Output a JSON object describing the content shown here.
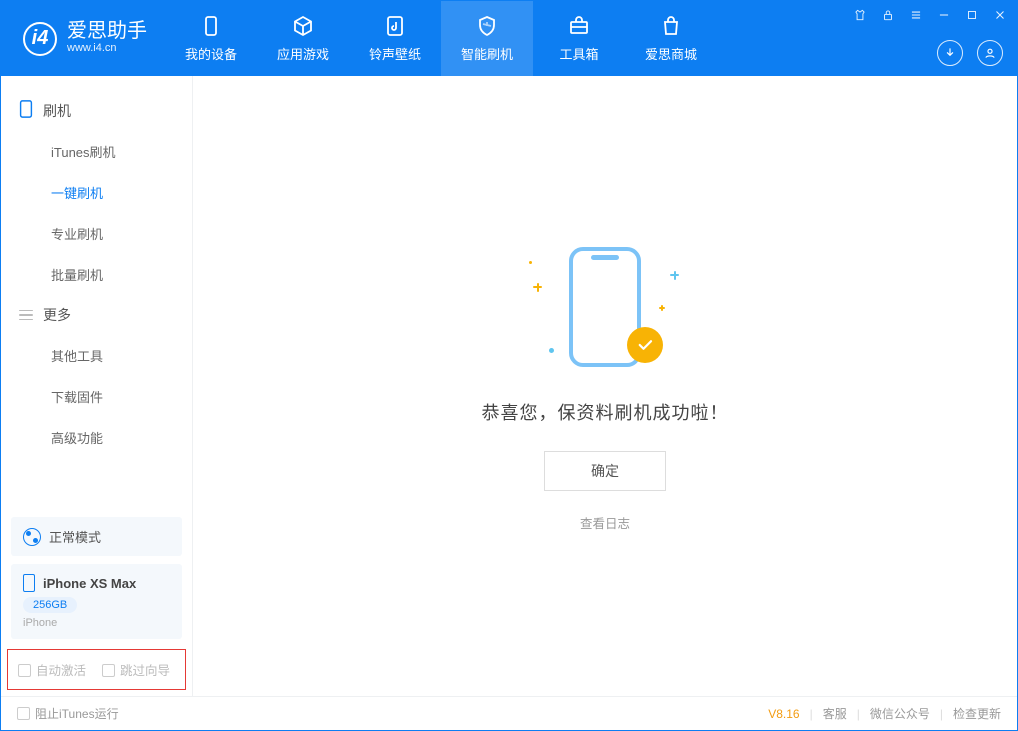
{
  "app": {
    "name_cn": "爱思助手",
    "name_en": "www.i4.cn"
  },
  "nav": {
    "items": [
      {
        "label": "我的设备",
        "icon": "device"
      },
      {
        "label": "应用游戏",
        "icon": "cube"
      },
      {
        "label": "铃声壁纸",
        "icon": "music-doc"
      },
      {
        "label": "智能刷机",
        "icon": "shield",
        "active": true
      },
      {
        "label": "工具箱",
        "icon": "toolbox"
      },
      {
        "label": "爱思商城",
        "icon": "bag"
      }
    ]
  },
  "sidebar": {
    "section_flash": {
      "title": "刷机",
      "items": [
        "iTunes刷机",
        "一键刷机",
        "专业刷机",
        "批量刷机"
      ],
      "active_index": 1
    },
    "section_more": {
      "title": "更多",
      "items": [
        "其他工具",
        "下载固件",
        "高级功能"
      ]
    },
    "mode_label": "正常模式",
    "device": {
      "name": "iPhone XS Max",
      "storage": "256GB",
      "type": "iPhone"
    },
    "checks": {
      "auto_activate": "自动激活",
      "skip_guide": "跳过向导"
    }
  },
  "main": {
    "success_msg": "恭喜您，保资料刷机成功啦！",
    "ok_btn": "确定",
    "view_log": "查看日志"
  },
  "footer": {
    "block_itunes": "阻止iTunes运行",
    "version": "V8.16",
    "links": [
      "客服",
      "微信公众号",
      "检查更新"
    ]
  }
}
